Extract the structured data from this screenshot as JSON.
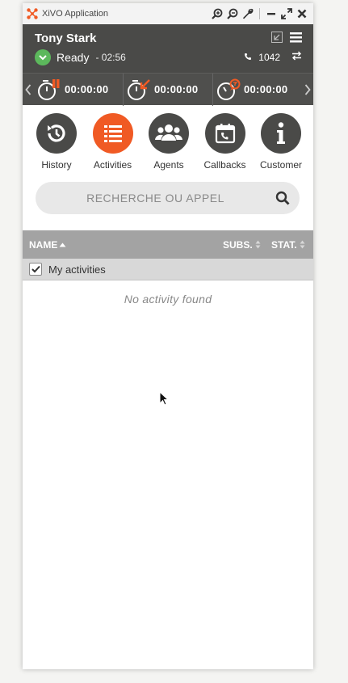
{
  "window": {
    "title": "XiVO Application"
  },
  "user": {
    "name": "Tony Stark",
    "status": "Ready",
    "status_time": "- 02:56",
    "phone_number": "1042"
  },
  "timers": [
    {
      "name": "pause-timer",
      "value": "00:00:00"
    },
    {
      "name": "incoming-timer",
      "value": "00:00:00"
    },
    {
      "name": "wrapup-timer",
      "value": "00:00:00"
    }
  ],
  "nav": {
    "history": "History",
    "activities": "Activities",
    "agents": "Agents",
    "callbacks": "Callbacks",
    "customer": "Customer"
  },
  "search": {
    "placeholder": "RECHERCHE OU APPEL"
  },
  "table": {
    "col_name": "NAME",
    "col_subs": "SUBS.",
    "col_stat": "STAT.",
    "group_label": "My activities",
    "empty_message": "No activity found"
  },
  "colors": {
    "accent": "#f05a24",
    "header": "#4a4a48",
    "ready": "#5cb85c"
  },
  "icons": [
    "xivo-logo-icon",
    "zoom-in-icon",
    "zoom-out-icon",
    "wrench-icon",
    "minimize-icon",
    "maximize-icon",
    "close-icon",
    "collapse-icon",
    "menu-icon",
    "check-icon",
    "phone-icon",
    "transfer-icon",
    "chevron-left-icon",
    "chevron-right-icon",
    "history-icon",
    "activities-icon",
    "agents-icon",
    "callbacks-icon",
    "customer-icon",
    "search-icon",
    "sort-asc-icon",
    "sort-icon",
    "mouse-cursor-icon"
  ]
}
